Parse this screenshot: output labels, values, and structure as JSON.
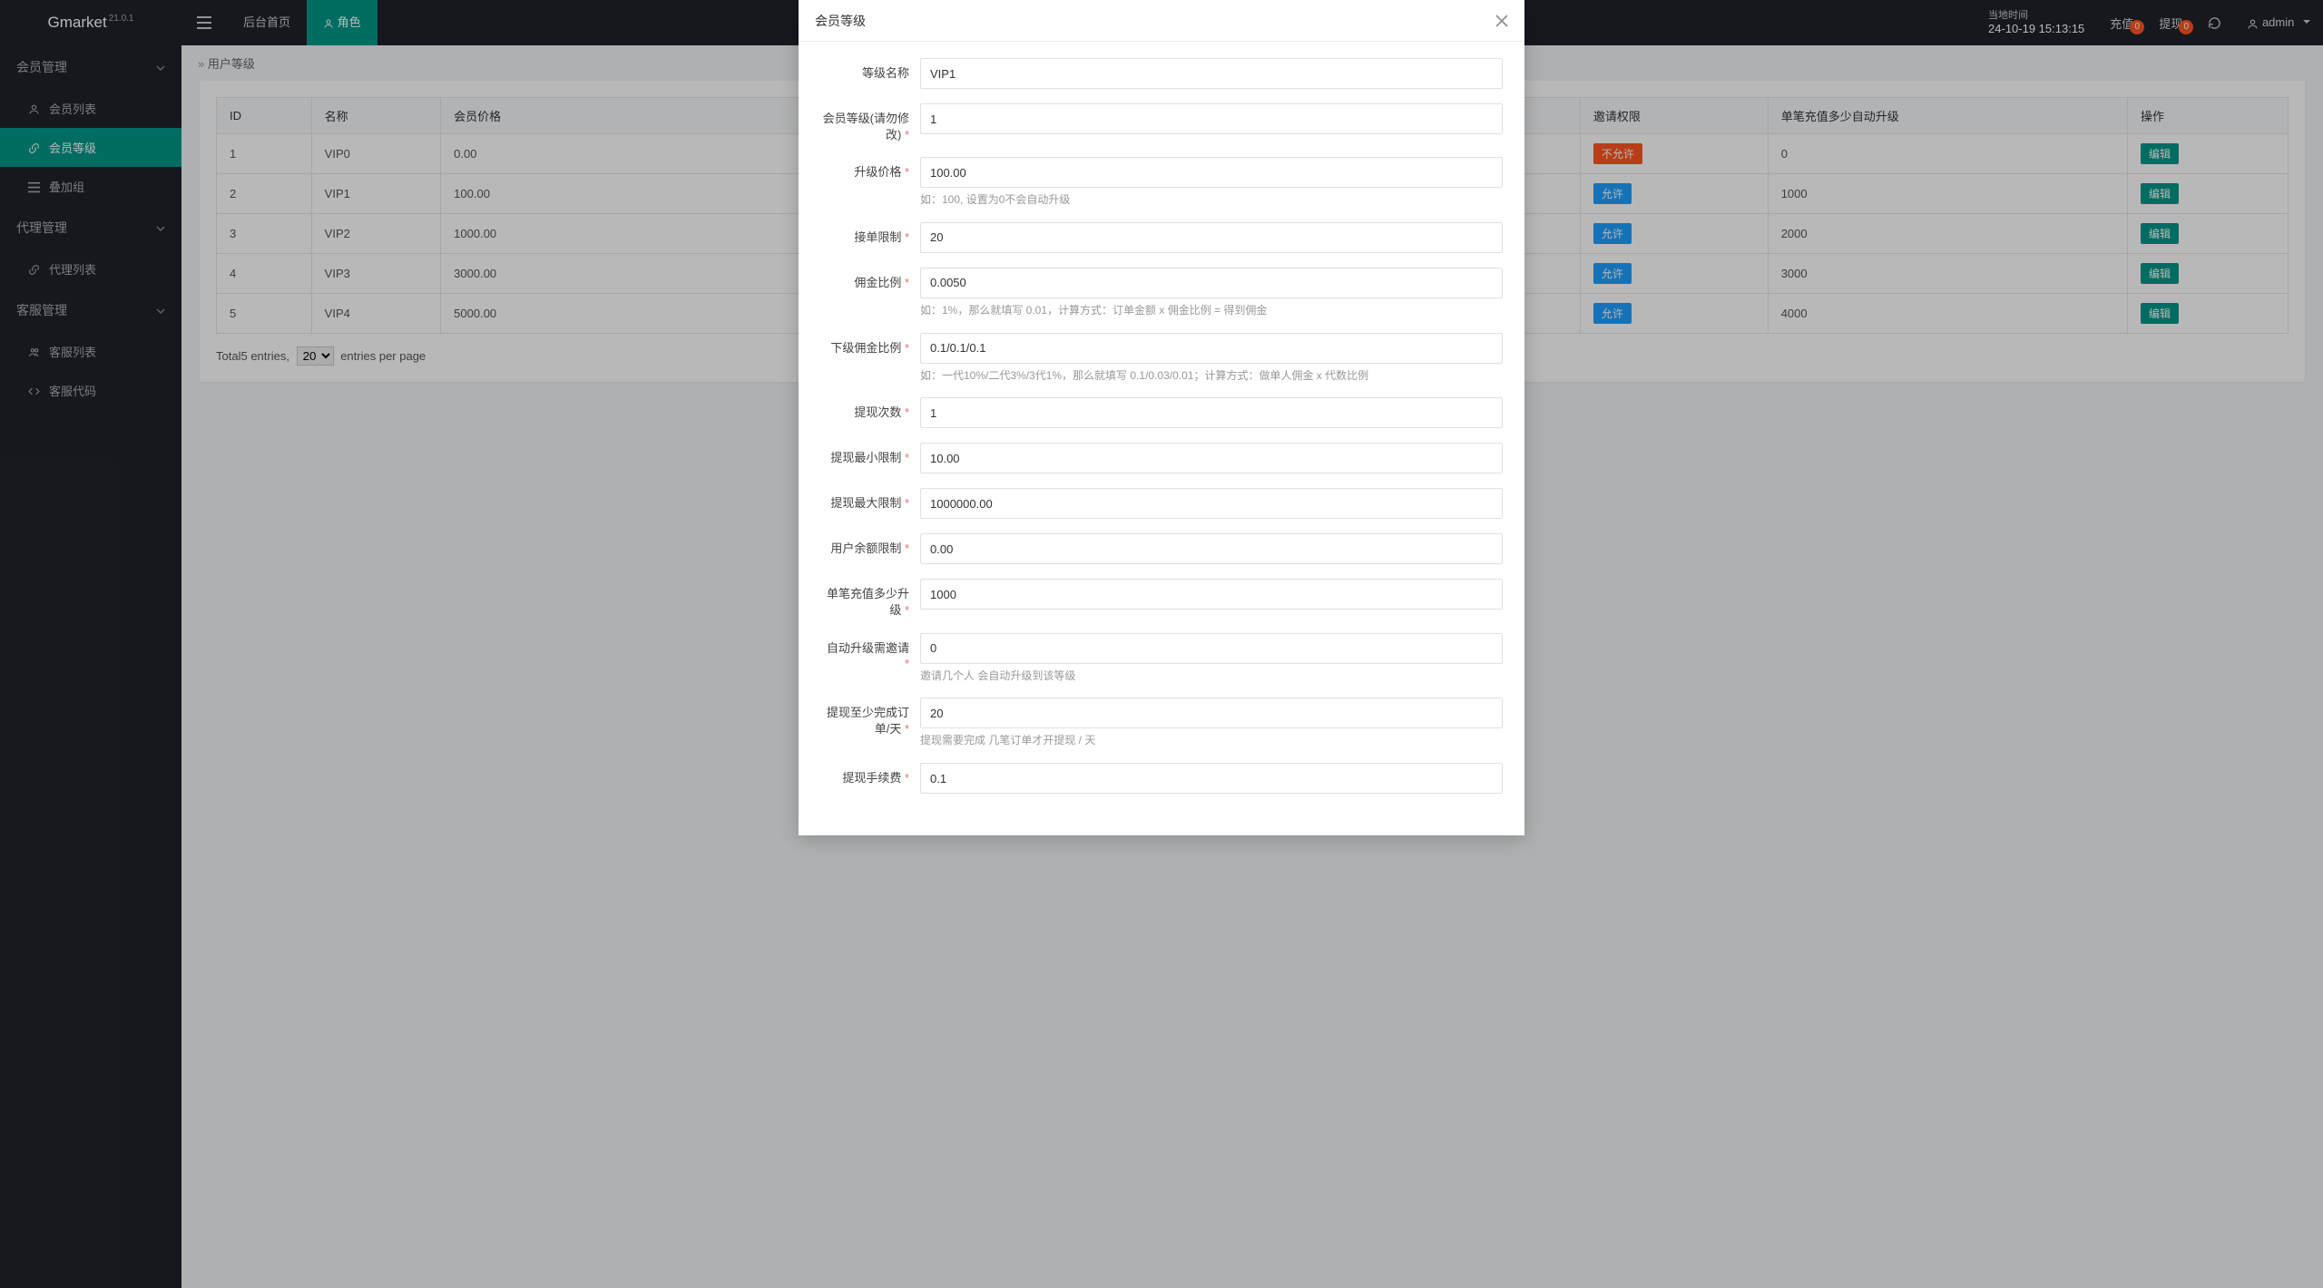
{
  "brand": {
    "name": "Gmarket",
    "version": "21.0.1"
  },
  "tabs": {
    "home": "后台首页",
    "role": "角色"
  },
  "topright": {
    "time_label": "当地时间",
    "time_value": "24-10-19 15:13:15",
    "recharge": "充值",
    "recharge_badge": "0",
    "withdraw": "提现",
    "withdraw_badge": "0",
    "user": "admin"
  },
  "sidebar": {
    "member_mgmt": "会员管理",
    "member_list": "会员列表",
    "member_level": "会员等级",
    "overlay_group": "叠加组",
    "agent_mgmt": "代理管理",
    "agent_list": "代理列表",
    "cs_mgmt": "客服管理",
    "cs_list": "客服列表",
    "cs_code": "客服代码"
  },
  "crumb": "用户等级",
  "table": {
    "headers": {
      "id": "ID",
      "name": "名称",
      "price": "会员价格",
      "invite": "邀请权限",
      "auto": "单笔充值多少自动升级",
      "op": "操作"
    },
    "rows": [
      {
        "id": "1",
        "name": "VIP0",
        "price": "0.00",
        "invite": "不允许",
        "invite_danger": true,
        "auto": "0"
      },
      {
        "id": "2",
        "name": "VIP1",
        "price": "100.00",
        "invite": "允许",
        "invite_danger": false,
        "auto": "1000"
      },
      {
        "id": "3",
        "name": "VIP2",
        "price": "1000.00",
        "invite": "允许",
        "invite_danger": false,
        "auto": "2000"
      },
      {
        "id": "4",
        "name": "VIP3",
        "price": "3000.00",
        "invite": "允许",
        "invite_danger": false,
        "auto": "3000"
      },
      {
        "id": "5",
        "name": "VIP4",
        "price": "5000.00",
        "invite": "允许",
        "invite_danger": false,
        "auto": "4000"
      }
    ],
    "edit_label": "编辑"
  },
  "pager": {
    "prefix": "Total",
    "count": "5",
    "mid": " entries,",
    "opt": "20",
    "suffix": "entries per page"
  },
  "modal": {
    "title": "会员等级",
    "fields": {
      "name": {
        "label": "等级名称",
        "value": "VIP1"
      },
      "level": {
        "label": "会员等级(请勿修改)",
        "value": "1"
      },
      "price": {
        "label": "升级价格",
        "value": "100.00",
        "help": "如：100, 设置为0不会自动升级"
      },
      "order_limit": {
        "label": "接单限制",
        "value": "20"
      },
      "commission": {
        "label": "佣金比例",
        "value": "0.0050",
        "help": "如：1%，那么就填写 0.01，计算方式：订单金额 x 佣金比例 = 得到佣金"
      },
      "sub_comm": {
        "label": "下级佣金比例",
        "value": "0.1/0.1/0.1",
        "help": "如：一代10%/二代3%/3代1%，那么就填写 0.1/0.03/0.01；计算方式：做单人佣金 x 代数比例"
      },
      "withdraw_cnt": {
        "label": "提现次数",
        "value": "1"
      },
      "withdraw_min": {
        "label": "提现最小限制",
        "value": "10.00"
      },
      "withdraw_max": {
        "label": "提现最大限制",
        "value": "1000000.00"
      },
      "balance_limit": {
        "label": "用户余额限制",
        "value": "0.00"
      },
      "auto_recharge": {
        "label": "单笔充值多少升级",
        "value": "1000"
      },
      "auto_invite": {
        "label": "自动升级需邀请",
        "value": "0",
        "help": "邀请几个人 会自动升级到该等级"
      },
      "min_orders": {
        "label": "提现至少完成订单/天",
        "value": "20",
        "help": "提现需要完成 几笔订单才开提现 / 天"
      },
      "fee": {
        "label": "提现手续费",
        "value": "0.1"
      }
    }
  }
}
